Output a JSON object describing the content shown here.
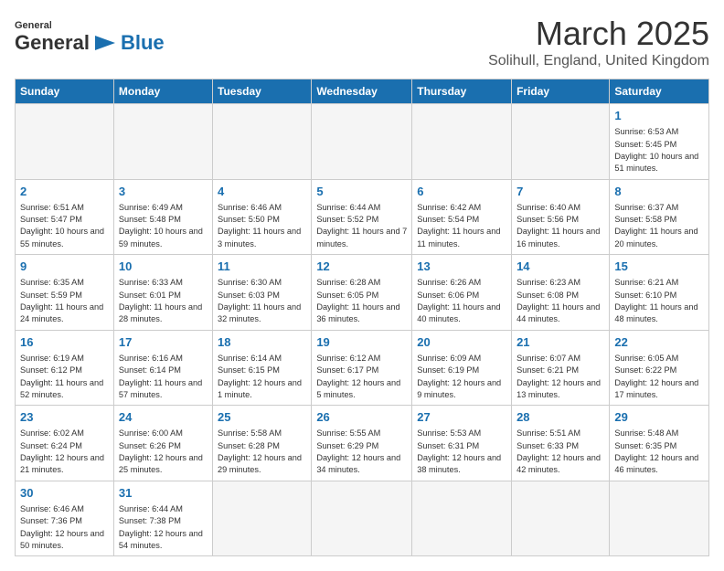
{
  "logo": {
    "general": "General",
    "blue": "Blue"
  },
  "title": "March 2025",
  "location": "Solihull, England, United Kingdom",
  "days_of_week": [
    "Sunday",
    "Monday",
    "Tuesday",
    "Wednesday",
    "Thursday",
    "Friday",
    "Saturday"
  ],
  "weeks": [
    [
      {
        "day": "",
        "info": ""
      },
      {
        "day": "",
        "info": ""
      },
      {
        "day": "",
        "info": ""
      },
      {
        "day": "",
        "info": ""
      },
      {
        "day": "",
        "info": ""
      },
      {
        "day": "",
        "info": ""
      },
      {
        "day": "1",
        "info": "Sunrise: 6:53 AM\nSunset: 5:45 PM\nDaylight: 10 hours and 51 minutes."
      }
    ],
    [
      {
        "day": "2",
        "info": "Sunrise: 6:51 AM\nSunset: 5:47 PM\nDaylight: 10 hours and 55 minutes."
      },
      {
        "day": "3",
        "info": "Sunrise: 6:49 AM\nSunset: 5:48 PM\nDaylight: 10 hours and 59 minutes."
      },
      {
        "day": "4",
        "info": "Sunrise: 6:46 AM\nSunset: 5:50 PM\nDaylight: 11 hours and 3 minutes."
      },
      {
        "day": "5",
        "info": "Sunrise: 6:44 AM\nSunset: 5:52 PM\nDaylight: 11 hours and 7 minutes."
      },
      {
        "day": "6",
        "info": "Sunrise: 6:42 AM\nSunset: 5:54 PM\nDaylight: 11 hours and 11 minutes."
      },
      {
        "day": "7",
        "info": "Sunrise: 6:40 AM\nSunset: 5:56 PM\nDaylight: 11 hours and 16 minutes."
      },
      {
        "day": "8",
        "info": "Sunrise: 6:37 AM\nSunset: 5:58 PM\nDaylight: 11 hours and 20 minutes."
      }
    ],
    [
      {
        "day": "9",
        "info": "Sunrise: 6:35 AM\nSunset: 5:59 PM\nDaylight: 11 hours and 24 minutes."
      },
      {
        "day": "10",
        "info": "Sunrise: 6:33 AM\nSunset: 6:01 PM\nDaylight: 11 hours and 28 minutes."
      },
      {
        "day": "11",
        "info": "Sunrise: 6:30 AM\nSunset: 6:03 PM\nDaylight: 11 hours and 32 minutes."
      },
      {
        "day": "12",
        "info": "Sunrise: 6:28 AM\nSunset: 6:05 PM\nDaylight: 11 hours and 36 minutes."
      },
      {
        "day": "13",
        "info": "Sunrise: 6:26 AM\nSunset: 6:06 PM\nDaylight: 11 hours and 40 minutes."
      },
      {
        "day": "14",
        "info": "Sunrise: 6:23 AM\nSunset: 6:08 PM\nDaylight: 11 hours and 44 minutes."
      },
      {
        "day": "15",
        "info": "Sunrise: 6:21 AM\nSunset: 6:10 PM\nDaylight: 11 hours and 48 minutes."
      }
    ],
    [
      {
        "day": "16",
        "info": "Sunrise: 6:19 AM\nSunset: 6:12 PM\nDaylight: 11 hours and 52 minutes."
      },
      {
        "day": "17",
        "info": "Sunrise: 6:16 AM\nSunset: 6:14 PM\nDaylight: 11 hours and 57 minutes."
      },
      {
        "day": "18",
        "info": "Sunrise: 6:14 AM\nSunset: 6:15 PM\nDaylight: 12 hours and 1 minute."
      },
      {
        "day": "19",
        "info": "Sunrise: 6:12 AM\nSunset: 6:17 PM\nDaylight: 12 hours and 5 minutes."
      },
      {
        "day": "20",
        "info": "Sunrise: 6:09 AM\nSunset: 6:19 PM\nDaylight: 12 hours and 9 minutes."
      },
      {
        "day": "21",
        "info": "Sunrise: 6:07 AM\nSunset: 6:21 PM\nDaylight: 12 hours and 13 minutes."
      },
      {
        "day": "22",
        "info": "Sunrise: 6:05 AM\nSunset: 6:22 PM\nDaylight: 12 hours and 17 minutes."
      }
    ],
    [
      {
        "day": "23",
        "info": "Sunrise: 6:02 AM\nSunset: 6:24 PM\nDaylight: 12 hours and 21 minutes."
      },
      {
        "day": "24",
        "info": "Sunrise: 6:00 AM\nSunset: 6:26 PM\nDaylight: 12 hours and 25 minutes."
      },
      {
        "day": "25",
        "info": "Sunrise: 5:58 AM\nSunset: 6:28 PM\nDaylight: 12 hours and 29 minutes."
      },
      {
        "day": "26",
        "info": "Sunrise: 5:55 AM\nSunset: 6:29 PM\nDaylight: 12 hours and 34 minutes."
      },
      {
        "day": "27",
        "info": "Sunrise: 5:53 AM\nSunset: 6:31 PM\nDaylight: 12 hours and 38 minutes."
      },
      {
        "day": "28",
        "info": "Sunrise: 5:51 AM\nSunset: 6:33 PM\nDaylight: 12 hours and 42 minutes."
      },
      {
        "day": "29",
        "info": "Sunrise: 5:48 AM\nSunset: 6:35 PM\nDaylight: 12 hours and 46 minutes."
      }
    ],
    [
      {
        "day": "30",
        "info": "Sunrise: 6:46 AM\nSunset: 7:36 PM\nDaylight: 12 hours and 50 minutes."
      },
      {
        "day": "31",
        "info": "Sunrise: 6:44 AM\nSunset: 7:38 PM\nDaylight: 12 hours and 54 minutes."
      },
      {
        "day": "",
        "info": ""
      },
      {
        "day": "",
        "info": ""
      },
      {
        "day": "",
        "info": ""
      },
      {
        "day": "",
        "info": ""
      },
      {
        "day": "",
        "info": ""
      }
    ]
  ]
}
